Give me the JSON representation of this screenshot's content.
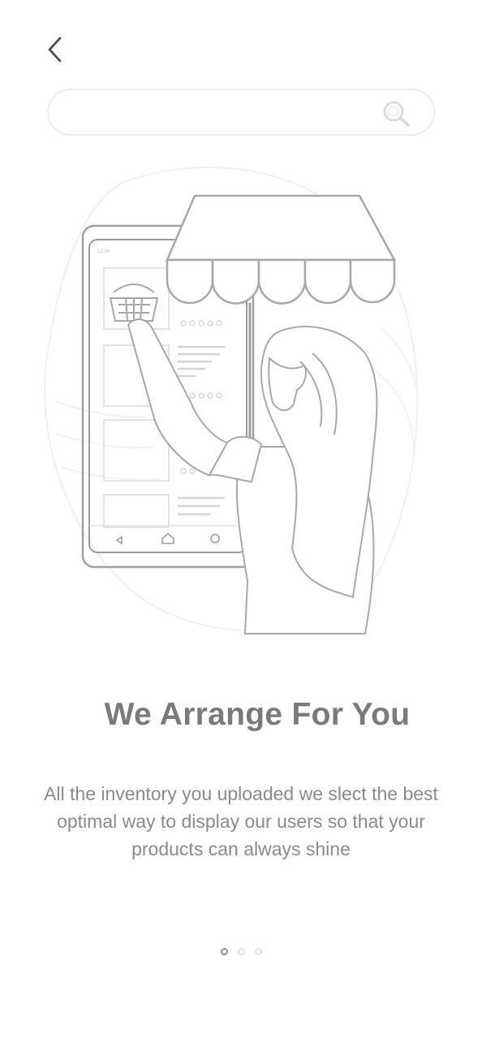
{
  "header": {
    "back_icon": "chevron-left-icon"
  },
  "search": {
    "value": "",
    "placeholder": "",
    "icon": "search-icon"
  },
  "illustration": {
    "phone_status": "12:30",
    "subject": "woman-shopping-on-phone-with-store-awning"
  },
  "onboarding": {
    "title": "We Arrange For You",
    "description": "All the inventory you uploaded we slect the best optimal way to display our users so that your products can always shine"
  },
  "pagination": {
    "total": 3,
    "active_index": 0
  },
  "colors": {
    "background": "#ffffff",
    "title": "#7a7a7a",
    "text": "#8a8a8a",
    "line_art": "#9a9a9a",
    "light_line": "#e0e0e0"
  }
}
